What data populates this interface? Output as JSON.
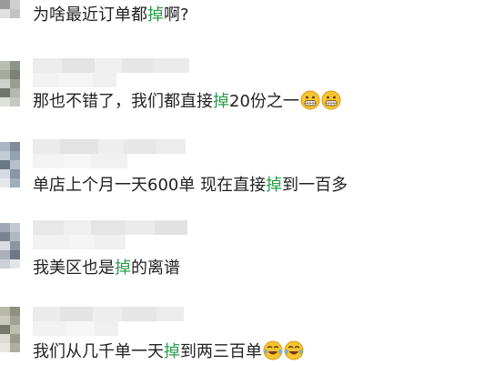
{
  "comments": [
    {
      "before": "为啥最近订单都",
      "keyword": "掉",
      "after": "啊?",
      "emojis": []
    },
    {
      "before": "那也不错了，我们都直接",
      "keyword": "掉",
      "after": "20份之一",
      "emojis": [
        "grinning-face-icon",
        "grinning-face-icon"
      ]
    },
    {
      "before": "单店上个月一天600单  现在直接",
      "keyword": "掉",
      "after": "到一百多",
      "emojis": []
    },
    {
      "before": "我美区也是",
      "keyword": "掉",
      "after": "的离谱",
      "emojis": []
    },
    {
      "before": "我们从几千单一天",
      "keyword": "掉",
      "after": "到两三百单",
      "emojis": [
        "crying-laughing-icon",
        "crying-laughing-icon"
      ]
    }
  ],
  "colors": {
    "text": "#222222",
    "keyword_highlight": "#2a9d4c",
    "emoji_face": "#f7c531",
    "pixelated_name": "#e9e9e9"
  }
}
